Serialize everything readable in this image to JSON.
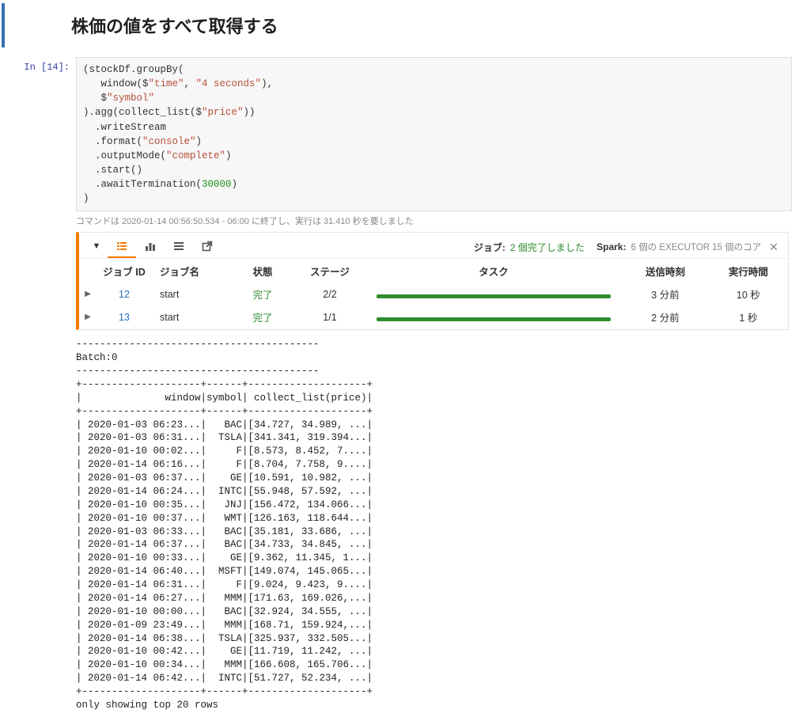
{
  "heading": "株価の値をすべて取得する",
  "prompt": {
    "label": "In",
    "num": "14"
  },
  "code": {
    "l1a": "(stockDf.groupBy(",
    "l2a": "   window($",
    "l2s1": "\"time\"",
    "l2b": ", ",
    "l2s2": "\"4 seconds\"",
    "l2c": "),",
    "l3a": "   $",
    "l3s1": "\"symbol\"",
    "l4a": ").agg(collect_list($",
    "l4s1": "\"price\"",
    "l4b": "))",
    "l5": "  .writeStream",
    "l6a": "  .format(",
    "l6s1": "\"console\"",
    "l6b": ")",
    "l7a": "  .outputMode(",
    "l7s1": "\"complete\"",
    "l7b": ")",
    "l8": "  .start()",
    "l9a": "  .awaitTermination(",
    "l9n": "30000",
    "l9b": ")",
    "l10": ")"
  },
  "cmd_status": "コマンドは 2020-01-14 00:56:50.534 - 06:00 に終了し、実行は 31.410 秒を要しました",
  "jobs_summary": {
    "job_label": "ジョブ:",
    "job_status": "2 個完了しました",
    "spark_label": "Spark:",
    "spark_detail": "6 個の EXECUTOR 15 個のコア"
  },
  "jobs_header": {
    "id": "ジョブ ID",
    "name": "ジョブ名",
    "status": "状態",
    "stage": "ステージ",
    "task": "タスク",
    "submitted": "送信時刻",
    "duration": "実行時間"
  },
  "jobs": [
    {
      "id": "12",
      "name": "start",
      "status": "完了",
      "stage": "2/2",
      "submitted": "3 分前",
      "duration": "10 秒"
    },
    {
      "id": "13",
      "name": "start",
      "status": "完了",
      "stage": "1/1",
      "submitted": "2 分前",
      "duration": "1 秒"
    }
  ],
  "chart_data": {
    "type": "table",
    "title": "Batch:0",
    "columns": [
      "window",
      "symbol",
      "collect_list(price)"
    ],
    "rows": [
      [
        "2020-01-03 06:23...",
        "BAC",
        "[34.727, 34.989, ..."
      ],
      [
        "2020-01-03 06:31...",
        "TSLA",
        "[341.341, 319.394..."
      ],
      [
        "2020-01-10 00:02...",
        "F",
        "[8.573, 8.452, 7...."
      ],
      [
        "2020-01-14 06:16...",
        "F",
        "[8.704, 7.758, 9...."
      ],
      [
        "2020-01-03 06:37...",
        "GE",
        "[10.591, 10.982, ..."
      ],
      [
        "2020-01-14 06:24...",
        "INTC",
        "[55.948, 57.592, ..."
      ],
      [
        "2020-01-10 00:35...",
        "JNJ",
        "[156.472, 134.066..."
      ],
      [
        "2020-01-10 00:37...",
        "WMT",
        "[126.163, 118.644..."
      ],
      [
        "2020-01-03 06:33...",
        "BAC",
        "[35.181, 33.686, ..."
      ],
      [
        "2020-01-14 06:37...",
        "BAC",
        "[34.733, 34.845, ..."
      ],
      [
        "2020-01-10 00:33...",
        "GE",
        "[9.362, 11.345, 1..."
      ],
      [
        "2020-01-14 06:40...",
        "MSFT",
        "[149.074, 145.065..."
      ],
      [
        "2020-01-14 06:31...",
        "F",
        "[9.024, 9.423, 9...."
      ],
      [
        "2020-01-14 06:27...",
        "MMM",
        "[171.63, 169.026,..."
      ],
      [
        "2020-01-10 00:00...",
        "BAC",
        "[32.924, 34.555, ..."
      ],
      [
        "2020-01-09 23:49...",
        "MMM",
        "[168.71, 159.924,..."
      ],
      [
        "2020-01-14 06:38...",
        "TSLA",
        "[325.937, 332.505..."
      ],
      [
        "2020-01-10 00:42...",
        "GE",
        "[11.719, 11.242, ..."
      ],
      [
        "2020-01-10 00:34...",
        "MMM",
        "[166.608, 165.706..."
      ],
      [
        "2020-01-14 06:42...",
        "INTC",
        "[51.727, 52.234, ..."
      ]
    ],
    "footer": "only showing top 20 rows"
  }
}
